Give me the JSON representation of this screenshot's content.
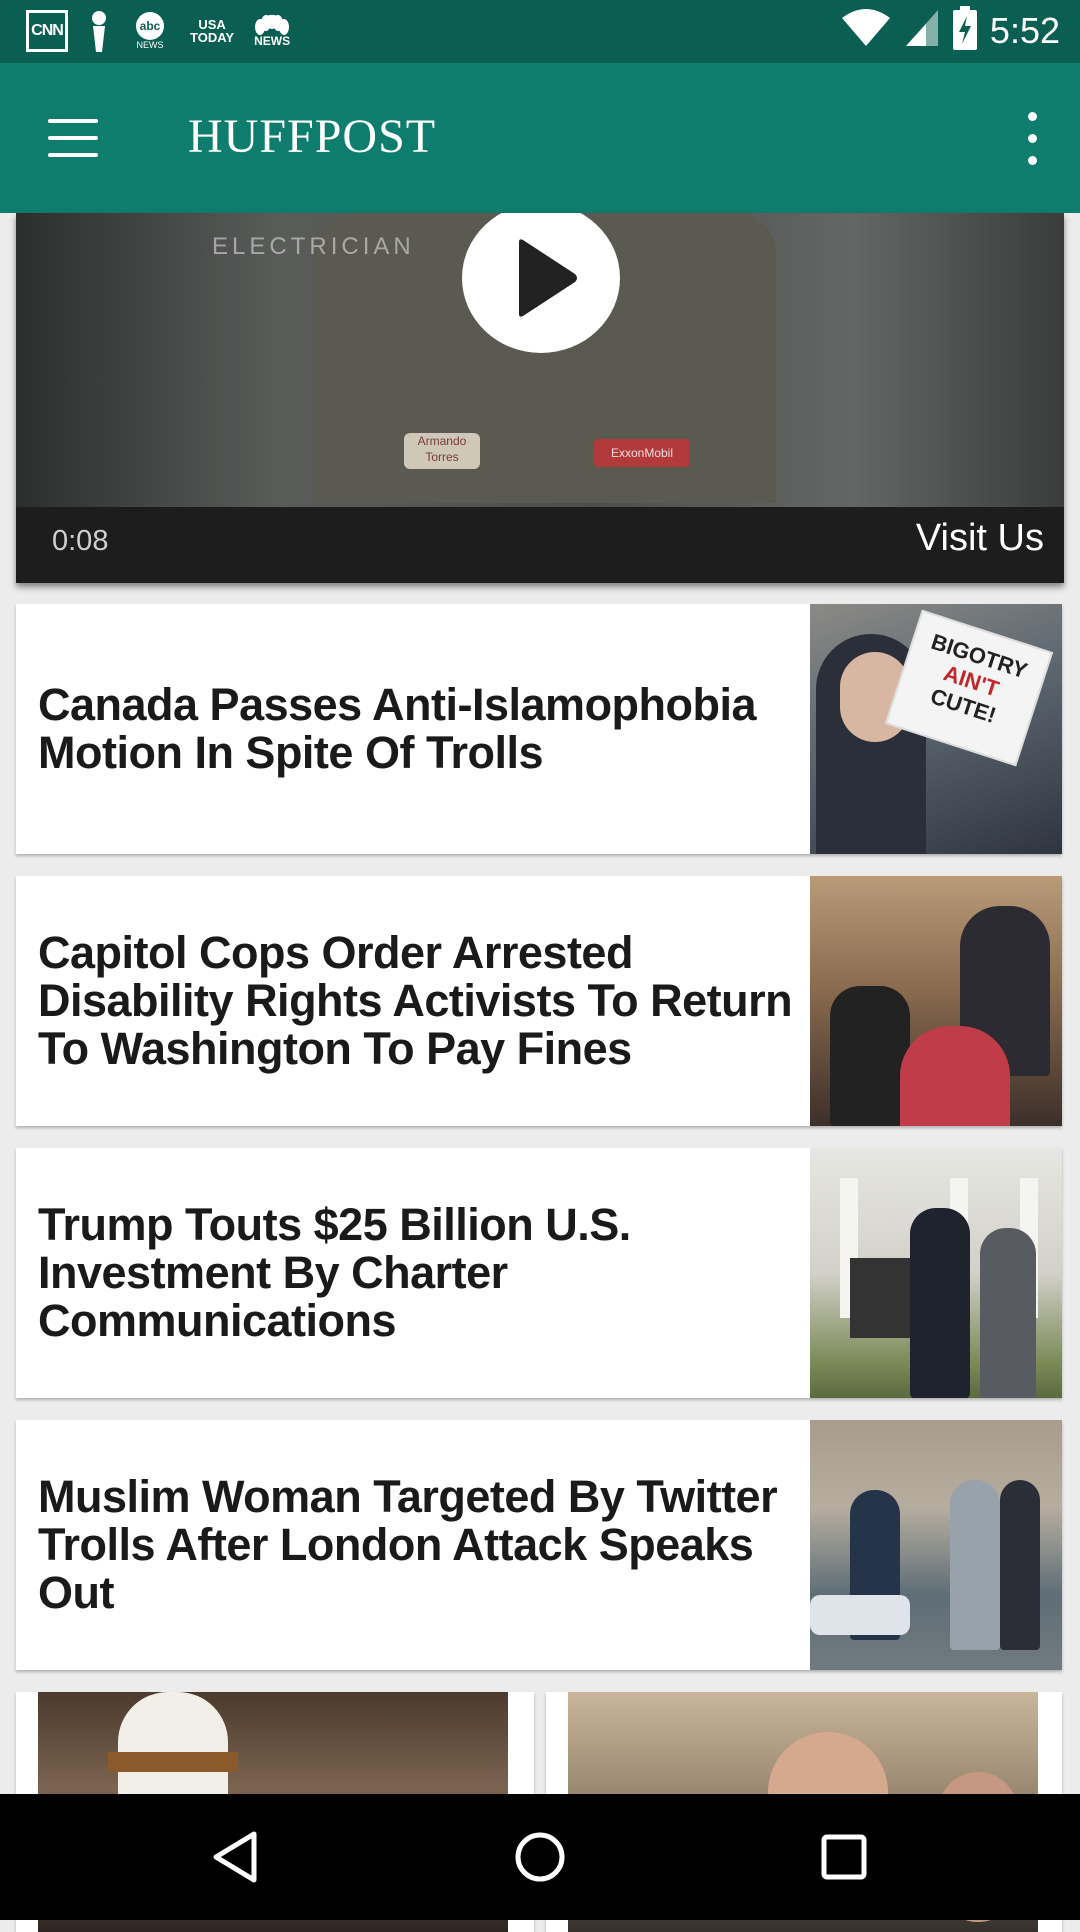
{
  "status_bar": {
    "notification_icons": [
      "cnn-icon",
      "tie-icon",
      "abc-news-icon",
      "usa-today-icon",
      "nbc-news-icon"
    ],
    "cnn_label": "CNN",
    "abc_label": "abc",
    "abc_sub": "NEWS",
    "usa_label": "USA",
    "today_label": "TODAY",
    "nbc_label": "NEWS",
    "time": "5:52"
  },
  "app_bar": {
    "title": "HUFFPOST",
    "color": "#0e7d6d"
  },
  "video": {
    "time": "0:08",
    "cta": "Visit Us",
    "watermark": "ELECTRICIAN",
    "patch_name": "Armando Torres",
    "patch_brand": "ExxonMobil"
  },
  "articles": [
    {
      "title": "Canada Passes Anti-Islamophobia Motion In Spite Of Trolls",
      "sign_lines": [
        "BIGOTRY",
        "AIN'T",
        "CUTE!"
      ]
    },
    {
      "title": "Capitol Cops Order Arrested Disability Rights Activists To Return To Washington To Pay Fines"
    },
    {
      "title": "Trump Touts $25 Billion U.S. Investment By Charter Communications"
    },
    {
      "title": "Muslim Woman Targeted By Twitter Trolls After London Attack Speaks Out"
    }
  ],
  "nav_bar": {
    "buttons": [
      "back",
      "home",
      "recents"
    ]
  }
}
